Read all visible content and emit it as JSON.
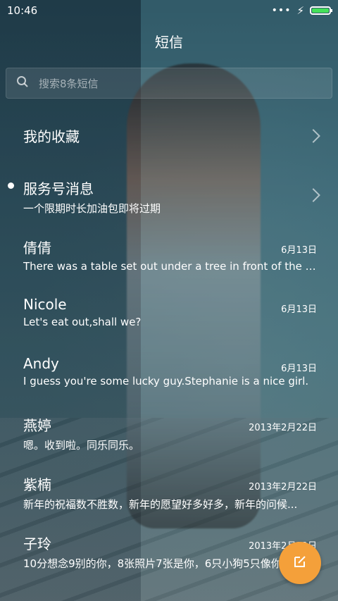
{
  "status_bar": {
    "time": "10:46",
    "dots": "•••"
  },
  "header": {
    "title": "短信"
  },
  "search": {
    "placeholder": "搜索8条短信"
  },
  "favorites": {
    "label": "我的收藏"
  },
  "service": {
    "label": "服务号消息",
    "message": "一个限期时长加油包即将过期"
  },
  "conversations": [
    {
      "name": "倩倩",
      "date": "6月13日",
      "message": "There was a table set out under a tree in front of the ho..."
    },
    {
      "name": "Nicole",
      "date": "6月13日",
      "message": "Let's eat out,shall we?"
    },
    {
      "name": "Andy",
      "date": "6月13日",
      "message": "I guess you're some lucky guy.Stephanie is a nice girl."
    },
    {
      "name": "燕婷",
      "date": "2013年2月22日",
      "message": "嗯。收到啦。同乐同乐。"
    },
    {
      "name": "紫楠",
      "date": "2013年2月22日",
      "message": "新年的祝福数不胜数，新年的愿望好多好多，新年的问候..."
    },
    {
      "name": "子玲",
      "date": "2013年2月22日",
      "message": "10分想念9别的你，8张照片7张是你，6只小狗5只像你"
    }
  ],
  "colors": {
    "fab": "#f4a03a",
    "battery": "#44e05a"
  }
}
